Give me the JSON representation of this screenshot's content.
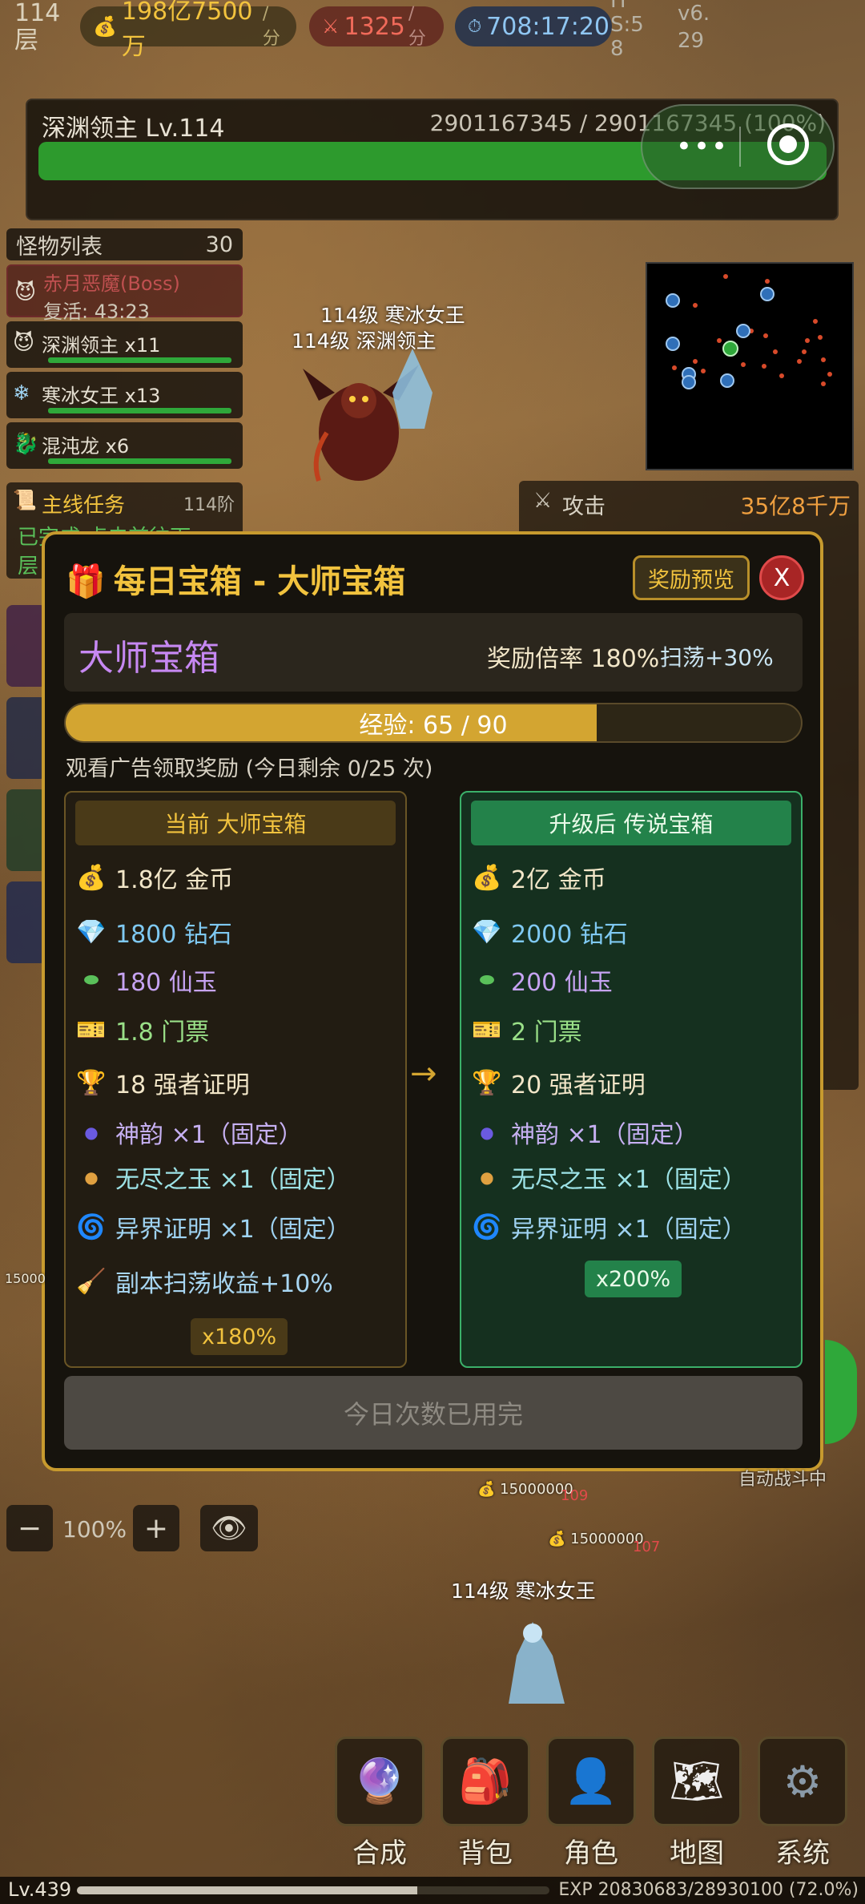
{
  "hud": {
    "floor_num": "114",
    "floor_unit": "层",
    "gold_rate": "198亿7500万",
    "gold_unit": "/分",
    "atk_rate": "1325",
    "atk_unit": "/分",
    "timer": "708:17:20",
    "s_line1": "H",
    "s_line2": "S:5",
    "s_line3": "8",
    "version_line1": "v6.",
    "version_line2": "29"
  },
  "boss": {
    "name": "深渊领主 Lv.114",
    "hp_text": "2901167345 / 2901167345 (100%)",
    "hp_percent": 100
  },
  "monster_list": {
    "title": "怪物列表",
    "count": "30",
    "items": [
      {
        "name": "赤月恶魔(Boss)",
        "sub": "复活: 43:23",
        "icon": "demon-icon"
      },
      {
        "name": "深渊领主 x11",
        "icon": "demon-icon"
      },
      {
        "name": "寒冰女王 x13",
        "icon": "snowflake-icon"
      },
      {
        "name": "混沌龙 x6",
        "icon": "dragon-icon"
      }
    ]
  },
  "field_labels": {
    "ice_queen_top": "114级 寒冰女王",
    "abyss_lord": "114级 深渊领主",
    "ice_queen_bottom": "114级 寒冰女王",
    "drop1": "15000000",
    "drop2": "15000000",
    "drop_side": "15000",
    "auto_battle": "自动战斗中",
    "dmg1": "109",
    "dmg2": "107"
  },
  "quest": {
    "title": "主线任务",
    "stage": "114阶",
    "line1": "已完成 点击前往下",
    "line2": "层"
  },
  "stats": {
    "attack_label": "攻击",
    "attack_value": "35亿8千万"
  },
  "modal": {
    "title": "每日宝箱 - 大师宝箱",
    "preview_button": "奖励预览",
    "close_button": "X",
    "tier_name": "大师宝箱",
    "reward_rate": "奖励倍率 180%",
    "sweep_bonus": "扫荡+30%",
    "exp_text": "经验: 65 / 90",
    "exp_progress": 0.722,
    "watch_hint": "观看广告领取奖励 (今日剩余 0/25 次)",
    "current": {
      "header": "当前 大师宝箱",
      "rows": [
        {
          "icon": "money-bag-icon",
          "text": "1.8亿 金币"
        },
        {
          "icon": "diamond-icon",
          "text": "1800 钻石"
        },
        {
          "icon": "jade-icon",
          "text": "180 仙玉"
        },
        {
          "icon": "ticket-icon",
          "text": "1.8 门票"
        },
        {
          "icon": "trophy-icon",
          "text": "18 强者证明"
        },
        {
          "icon": "orb-dark-icon",
          "text": "神韵 ×1（固定）"
        },
        {
          "icon": "orb-gold-icon",
          "text": "无尽之玉 ×1（固定）"
        },
        {
          "icon": "swirl-icon",
          "text": "异界证明 ×1（固定）"
        },
        {
          "icon": "broom-icon",
          "text": "副本扫荡收益+10%"
        }
      ],
      "multiplier": "x180%"
    },
    "next": {
      "header": "升级后 传说宝箱",
      "rows": [
        {
          "icon": "money-bag-icon",
          "text": "2亿 金币"
        },
        {
          "icon": "diamond-icon",
          "text": "2000 钻石"
        },
        {
          "icon": "jade-icon",
          "text": "200 仙玉"
        },
        {
          "icon": "ticket-icon",
          "text": "2 门票"
        },
        {
          "icon": "trophy-icon",
          "text": "20 强者证明"
        },
        {
          "icon": "orb-dark-icon",
          "text": "神韵 ×1（固定）"
        },
        {
          "icon": "orb-gold-icon",
          "text": "无尽之玉 ×1（固定）"
        },
        {
          "icon": "swirl-icon",
          "text": "异界证明 ×1（固定）"
        }
      ],
      "multiplier": "x200%"
    },
    "arrow": "→",
    "claim_button": "今日次数已用完"
  },
  "zoom": {
    "minus": "−",
    "level": "100%",
    "plus": "+"
  },
  "nav": [
    {
      "label": "合成",
      "icon": "crystal-ball-icon"
    },
    {
      "label": "背包",
      "icon": "backpack-icon"
    },
    {
      "label": "角色",
      "icon": "person-icon"
    },
    {
      "label": "地图",
      "icon": "map-icon"
    },
    {
      "label": "系统",
      "icon": "gear-icon"
    }
  ],
  "player": {
    "level": "Lv.439",
    "exp_text": "EXP 20830683/28930100 (72.0%)",
    "exp_progress": 0.72
  },
  "colors": {
    "gold_accent": "#f2c33e",
    "hp_green": "#2d9a2d",
    "modal_border": "#c79a2e",
    "legend_green": "#23824a"
  }
}
